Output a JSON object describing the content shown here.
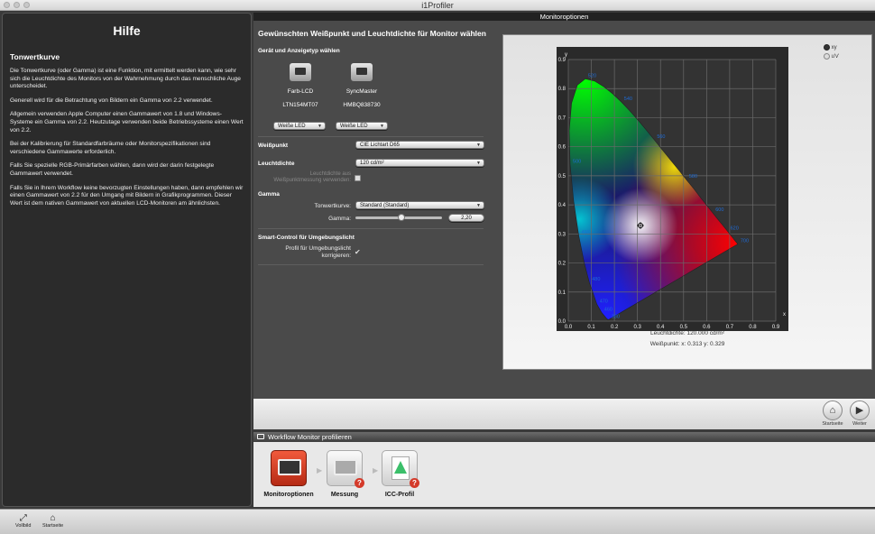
{
  "app": {
    "title": "i1Profiler"
  },
  "help": {
    "title": "Hilfe",
    "subtitle": "Tonwertkurve",
    "paragraphs": [
      "Die Tonwertkurve (oder Gamma) ist eine Funktion, mit ermittelt werden kann, wie sehr sich die Leuchtdichte des Monitors von der Wahrnehmung durch das menschliche Auge unterscheidet.",
      "Generell wird für die Betrachtung von Bildern ein Gamma von 2.2 verwendet.",
      "Allgemein verwenden Apple Computer einen Gammawert von 1.8 und Windows-Systeme ein Gamma von 2.2. Heutzutage verwenden beide Betriebssysteme einen Wert von 2.2.",
      "Bei der Kalibrierung für Standardfarbräume oder Monitorspezifikationen sind verschiedene Gammawerte erforderlich.",
      "Falls Sie spezielle RGB-Primärfarben wählen, dann wird der darin festgelegte Gammawert verwendet.",
      "Falls Sie in Ihrem Workflow keine bevorzugten Einstellungen haben, dann empfehlen wir einen Gammawert von 2.2 für den Umgang mit Bildern in Grafikprogrammen. Dieser Wert ist dem nativen Gammawert von aktuellen LCD-Monitoren am ähnlichsten."
    ]
  },
  "main": {
    "header": "Monitoroptionen",
    "heading": "Gewünschten Weißpunkt und Leuchtdichte für Monitor wählen",
    "device_section": "Gerät und Anzeigetyp wählen",
    "devices": [
      {
        "name": "Farb-LCD",
        "model": "LTN154MT07",
        "type": "Weiße LED"
      },
      {
        "name": "SyncMaster",
        "model": "HMBQ838730",
        "type": "Weiße LED"
      }
    ],
    "whitepoint_label": "Weißpunkt",
    "whitepoint_value": "CIE Lichtart D65",
    "luminance_label": "Leuchtdichte",
    "luminance_value": "120 cd/m²",
    "luminance_measure_label": "Leuchtdichte aus Weißpunktmessung verwenden:",
    "gamma_section": "Gamma",
    "tone_curve_label": "Tonwertkurve:",
    "tone_curve_value": "Standard (Standard)",
    "gamma_label": "Gamma:",
    "gamma_value": "2,20",
    "gamma_level": 0.53,
    "ambient_section": "Smart-Control für Umgebungslicht",
    "ambient_label": "Profil für Umgebungslicht korrigieren:"
  },
  "plot": {
    "radio_xy": "xy",
    "radio_uv": "u'v'",
    "luminance_text": "Leuchtdichte: 120.000 cd/m²",
    "whitepoint_text": "Weißpunkt: x: 0.313  y: 0.329"
  },
  "chart_data": {
    "type": "scatter",
    "title": "",
    "xlabel": "x",
    "ylabel": "y",
    "xlim": [
      0,
      0.9
    ],
    "ylim": [
      0,
      0.9
    ],
    "xticks": [
      "0.0",
      "0.1",
      "0.2",
      "0.3",
      "0.4",
      "0.5",
      "0.6",
      "0.7",
      "0.8",
      "0.9"
    ],
    "yticks": [
      "0.0",
      "0.1",
      "0.2",
      "0.3",
      "0.4",
      "0.5",
      "0.6",
      "0.7",
      "0.8",
      "0.9"
    ],
    "grid": true,
    "locus": [
      [
        0.175,
        0.005
      ],
      [
        0.172,
        0.005
      ],
      [
        0.166,
        0.009
      ],
      [
        0.144,
        0.03
      ],
      [
        0.124,
        0.058
      ],
      [
        0.091,
        0.133
      ],
      [
        0.069,
        0.201
      ],
      [
        0.045,
        0.295
      ],
      [
        0.023,
        0.413
      ],
      [
        0.008,
        0.538
      ],
      [
        0.004,
        0.655
      ],
      [
        0.014,
        0.75
      ],
      [
        0.039,
        0.812
      ],
      [
        0.074,
        0.834
      ],
      [
        0.114,
        0.826
      ],
      [
        0.155,
        0.806
      ],
      [
        0.193,
        0.782
      ],
      [
        0.23,
        0.754
      ],
      [
        0.266,
        0.724
      ],
      [
        0.302,
        0.692
      ],
      [
        0.337,
        0.659
      ],
      [
        0.373,
        0.624
      ],
      [
        0.408,
        0.589
      ],
      [
        0.444,
        0.554
      ],
      [
        0.479,
        0.52
      ],
      [
        0.512,
        0.487
      ],
      [
        0.545,
        0.455
      ],
      [
        0.575,
        0.424
      ],
      [
        0.603,
        0.396
      ],
      [
        0.627,
        0.372
      ],
      [
        0.648,
        0.351
      ],
      [
        0.666,
        0.334
      ],
      [
        0.68,
        0.32
      ],
      [
        0.691,
        0.309
      ],
      [
        0.7,
        0.3
      ],
      [
        0.707,
        0.293
      ],
      [
        0.713,
        0.287
      ],
      [
        0.719,
        0.281
      ],
      [
        0.726,
        0.274
      ],
      [
        0.735,
        0.265
      ]
    ],
    "wavelength_labels": [
      {
        "text": "380",
        "x": 0.175,
        "y": 0.005
      },
      {
        "text": "460",
        "x": 0.144,
        "y": 0.03
      },
      {
        "text": "470",
        "x": 0.124,
        "y": 0.058
      },
      {
        "text": "480",
        "x": 0.091,
        "y": 0.133
      },
      {
        "text": "490",
        "x": 0.045,
        "y": 0.295
      },
      {
        "text": "500",
        "x": 0.008,
        "y": 0.538
      },
      {
        "text": "520",
        "x": 0.074,
        "y": 0.834
      },
      {
        "text": "540",
        "x": 0.23,
        "y": 0.754
      },
      {
        "text": "560",
        "x": 0.373,
        "y": 0.624
      },
      {
        "text": "580",
        "x": 0.512,
        "y": 0.487
      },
      {
        "text": "600",
        "x": 0.627,
        "y": 0.372
      },
      {
        "text": "620",
        "x": 0.691,
        "y": 0.309
      },
      {
        "text": "700",
        "x": 0.735,
        "y": 0.265
      }
    ],
    "white_point": {
      "x": 0.313,
      "y": 0.329
    },
    "colors": {
      "label": "#1e6bd6",
      "plot_bg": "#333333",
      "grid": "#6a6a6a"
    }
  },
  "nav": {
    "home": "Startseite",
    "next": "Weiter"
  },
  "workflow": {
    "title": "Workflow Monitor profilieren",
    "steps": [
      {
        "label": "Monitoroptionen"
      },
      {
        "label": "Messung"
      },
      {
        "label": "ICC-Profil"
      }
    ]
  },
  "footer": {
    "fullscreen": "Vollbild",
    "home": "Startseite"
  },
  "colors": {
    "accent": "#d43a2a",
    "panel": "#4a4a4a"
  }
}
